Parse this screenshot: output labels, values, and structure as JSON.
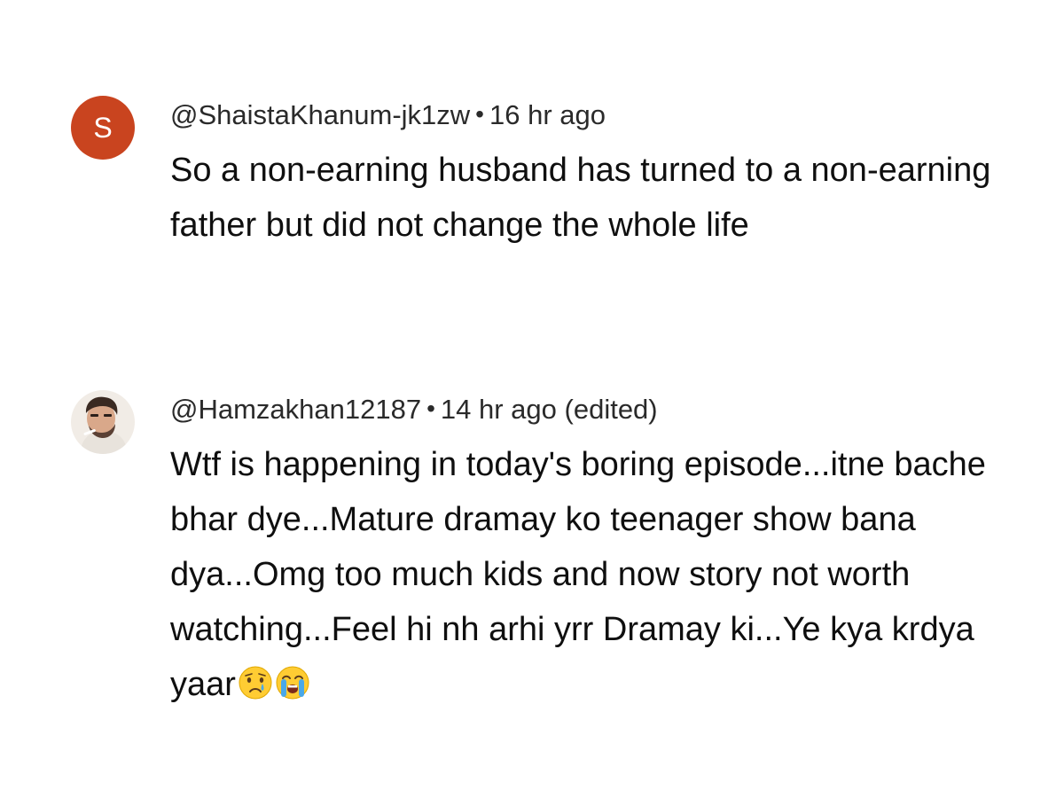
{
  "comments": [
    {
      "avatar_letter": "S",
      "avatar_color": "#c9441f",
      "handle": "@ShaistaKhanum-jk1zw",
      "separator": "•",
      "time": "16 hr ago",
      "text": "So a non-earning husband has turned to a non-earning father but did not change the whole life"
    },
    {
      "avatar_icon": "profile-photo",
      "handle": "@Hamzakhan12187",
      "separator": "•",
      "time": "14 hr ago (edited)",
      "text": "Wtf is happening in today's boring episode...itne bache bhar dye...Mature dramay ko teenager show bana dya...Omg too much kids and now story not worth watching...Feel hi nh arhi yrr Dramay ki...Ye kya krdya yaar",
      "emojis": [
        "crying-face-emoji",
        "loudly-crying-face-emoji"
      ]
    }
  ]
}
